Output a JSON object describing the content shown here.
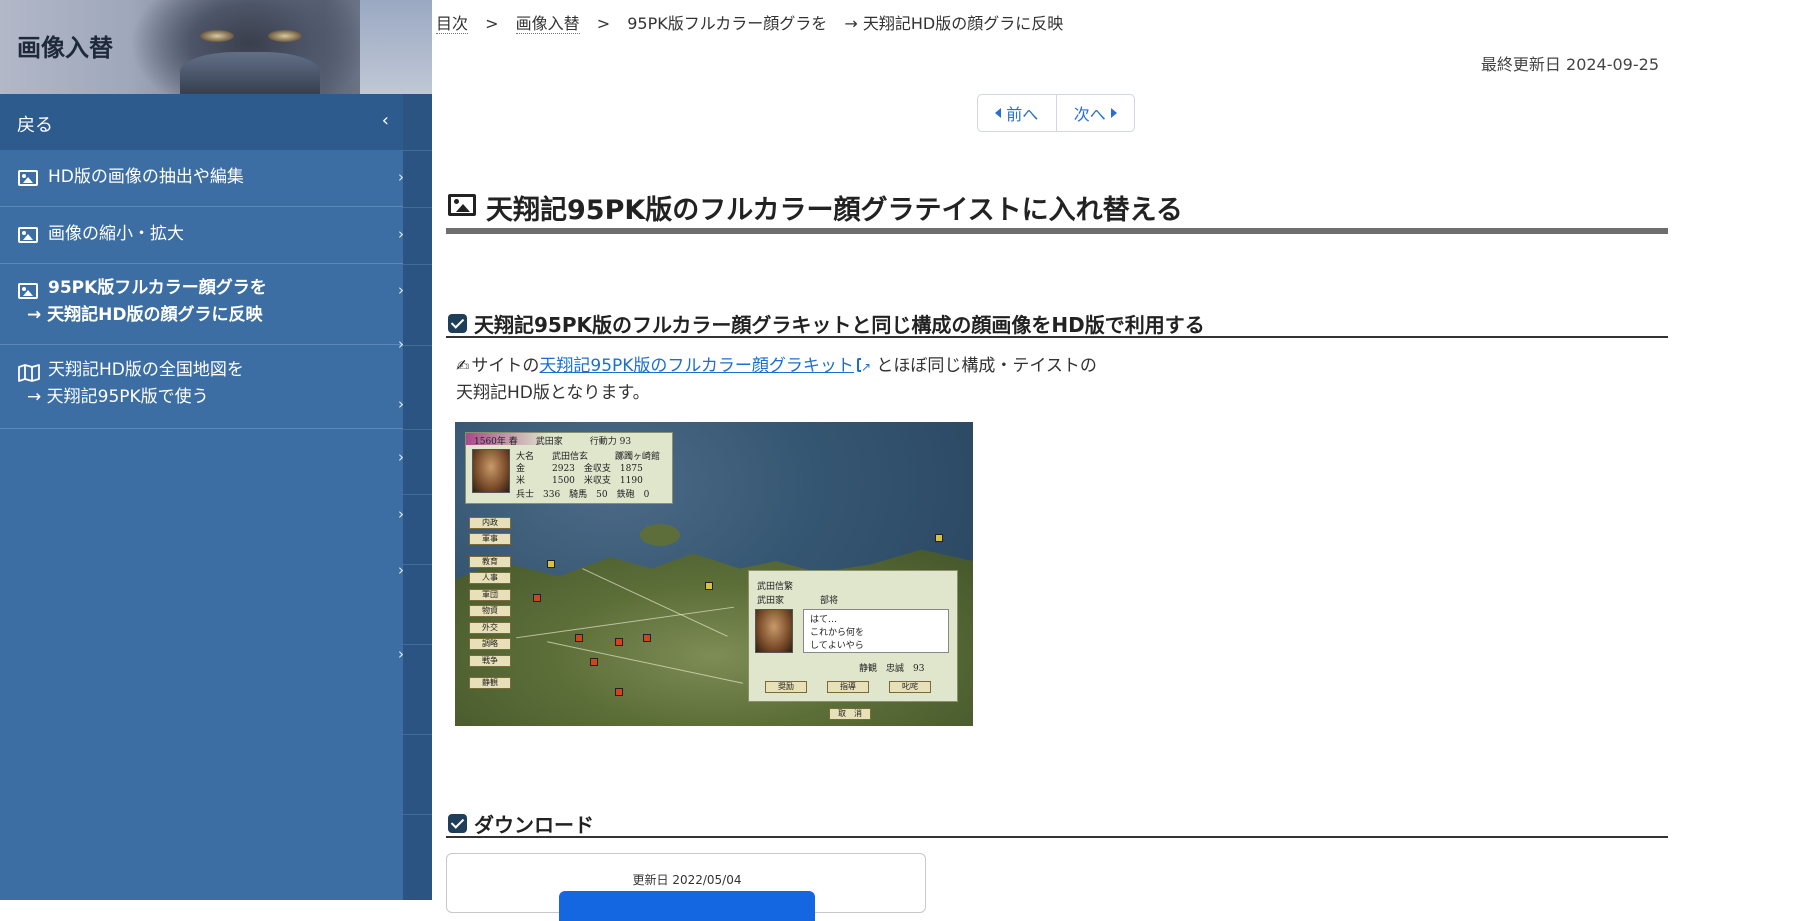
{
  "sidebar": {
    "site_title": "画像入替",
    "back_label": "戻る",
    "items": [
      {
        "lines": [
          "HD版の画像の抽出や編集"
        ],
        "icon": "image-icon"
      },
      {
        "lines": [
          "画像の縮小・拡大"
        ],
        "icon": "image-icon"
      },
      {
        "lines": [
          "95PK版フルカラー顔グラを",
          "→ 天翔記HD版の顔グラに反映"
        ],
        "icon": "image-icon",
        "active": true
      },
      {
        "lines": [
          "天翔記HD版の全国地図を",
          "→ 天翔記95PK版で使う"
        ],
        "icon": "map-icon"
      }
    ]
  },
  "breadcrumb": {
    "home": "目次",
    "section": "画像入替",
    "current_part1": "95PK版フルカラー顔グラを",
    "current_part2": "→ 天翔記HD版の顔グラに反映",
    "separator": ">"
  },
  "updated": "最終更新日 2024-09-25",
  "pager": {
    "prev": "前へ",
    "next": "次へ"
  },
  "page_title": "天翔記95PK版のフルカラー顔グラテイストに入れ替える",
  "section1": {
    "heading": "天翔記95PK版のフルカラー顔グラキットと同じ構成の顔画像をHD版で利用する",
    "text_before": "サイトの",
    "link": "天翔記95PK版のフルカラー顔グラキット",
    "text_after": " とほぼ同じ構成・テイストの",
    "text_line2": "天翔記HD版となります。"
  },
  "screenshot": {
    "top_bar": "1560年 春　　武田家　　　行動力 93",
    "rows": [
      "大名　　武田信玄　　　躑躅ヶ崎館",
      "金　　　2923　金収支　1875",
      "米　　　1500　米収支　1190",
      "兵士　336　騎馬　50　鉄砲　0"
    ],
    "menu": [
      "内政",
      "軍事",
      "教育",
      "人事",
      "軍団",
      "物資",
      "外交",
      "調略",
      "戦争",
      "静観"
    ],
    "dialog_name": "武田信繁",
    "dialog_clan": "武田家　　　　部将",
    "dialog_lines": [
      "はて…",
      "これから何を",
      "してよいやら"
    ],
    "dialog_stats": "静観　忠誠　93",
    "dialog_buttons": [
      "奨励",
      "指導",
      "叱咤"
    ],
    "cancel": "取　消"
  },
  "section2": {
    "heading": "ダウンロード"
  },
  "download": {
    "date": "更新日 2022/05/04"
  },
  "colors": {
    "sidebar": "#3c6ea3",
    "accent_link": "#1a6fd0",
    "download_button": "#1467e0"
  }
}
